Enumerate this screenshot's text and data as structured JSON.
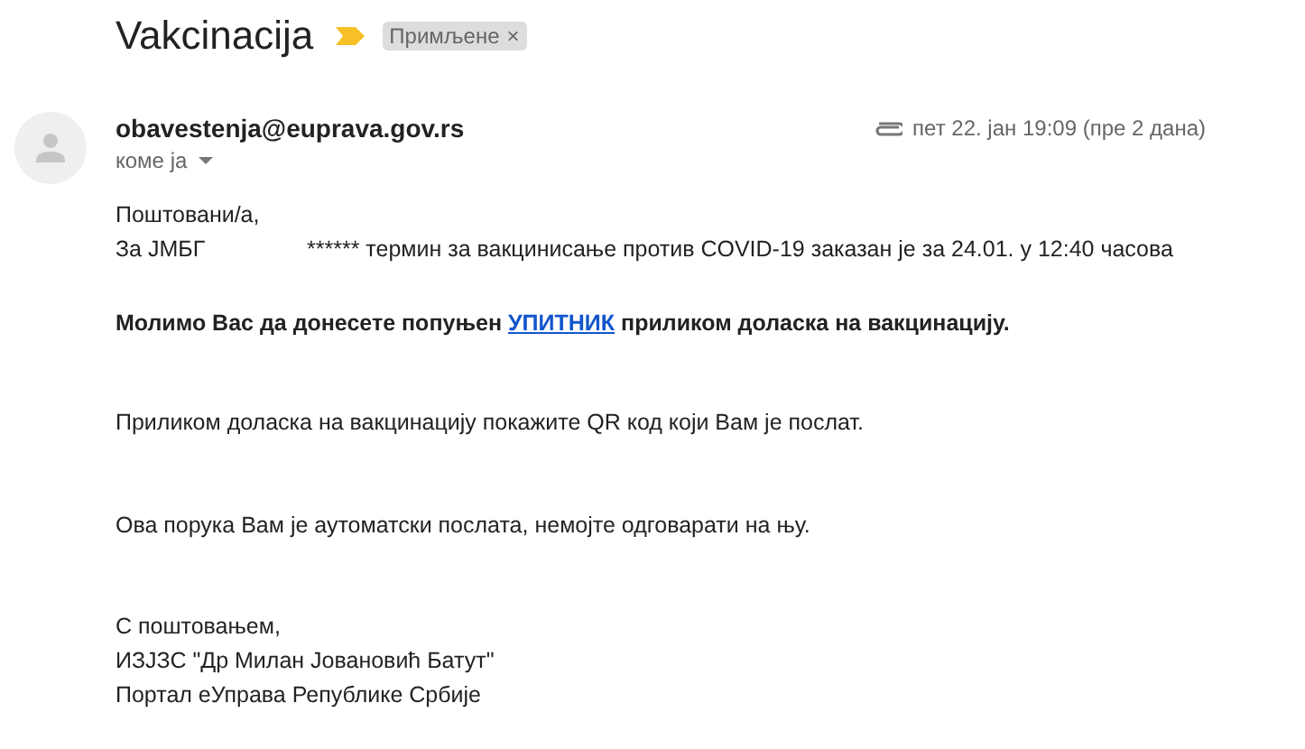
{
  "subject": "Vakcinacija",
  "important": true,
  "label": {
    "text": "Примљене",
    "remove": "×"
  },
  "sender": {
    "email": "obavestenja@euprava.gov.rs",
    "recipient": "коме ја",
    "has_attachment": true,
    "date": "пет 22. јан 19:09 (пре 2 дана)"
  },
  "body": [
    {
      "kind": "text",
      "lines": [
        [
          "Поштовани/а,"
        ],
        [
          "За ЈМБГ",
          "****** термин за вакцинисање против COVID-19 заказан је за 24.01. у 12:40 часова"
        ]
      ]
    },
    {
      "kind": "mixed",
      "bold": true,
      "parts": [
        {
          "kind": "text",
          "text": "Молимо Вас да донесете попуњен"
        },
        {
          "kind": "link",
          "text": "УПИТНИК"
        },
        {
          "kind": "text",
          "text": "приликом доласка на вакцинацију."
        }
      ]
    },
    {
      "kind": "text",
      "lines": [
        [
          "Приликом доласка на вакцинацију покажите QR код који Вам је послат."
        ]
      ]
    },
    {
      "kind": "text",
      "lines": [
        [
          "Ова порука Вам је аутоматски послата, немојте одговарати на њу."
        ]
      ]
    },
    {
      "kind": "text",
      "lines": [
        [
          "С поштовањем,"
        ],
        [
          "ИЗЈЗС \"Др Милан Јовановић Батут\""
        ],
        [
          "Портал еУправа Републике Србије"
        ]
      ]
    }
  ]
}
